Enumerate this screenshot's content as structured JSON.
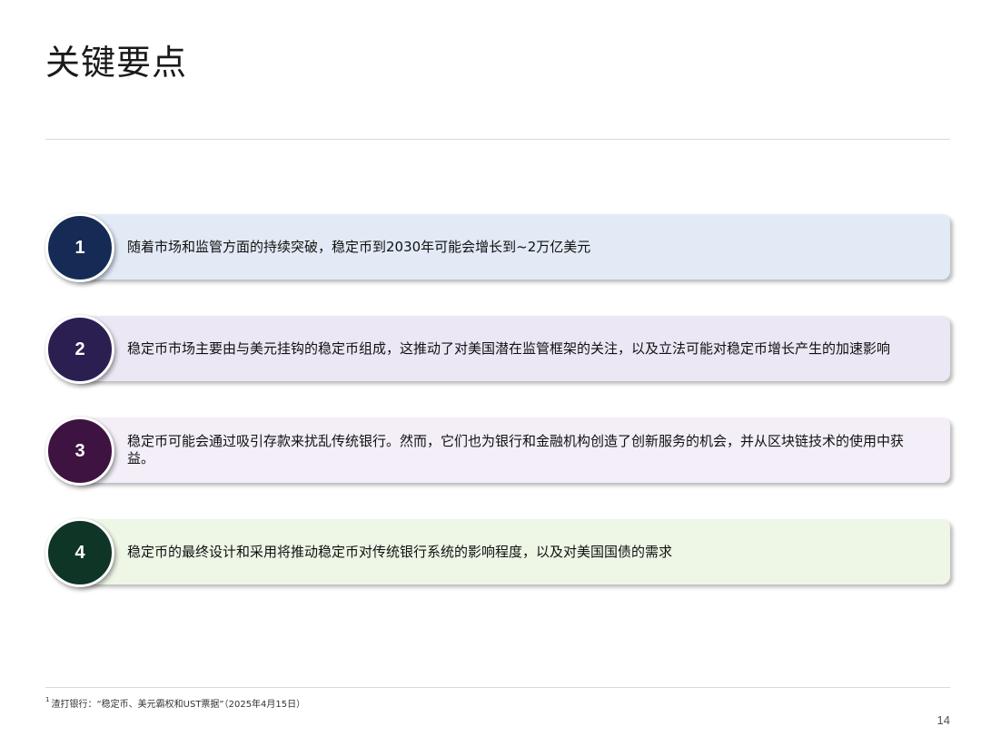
{
  "title": "关键要点",
  "points": [
    {
      "number": "1",
      "text": "随着市场和监管方面的持续突破，稳定币到2030年可能会增长到~2万亿美元",
      "circle_color": "#152b55",
      "bar_color": "#e2eaf5"
    },
    {
      "number": "2",
      "text": "稳定币市场主要由与美元挂钩的稳定币组成，这推动了对美国潜在监管框架的关注，以及立法可能对稳定币增长产生的加速影响",
      "circle_color": "#2b1f52",
      "bar_color": "#ebe7f4"
    },
    {
      "number": "3",
      "text": "稳定币可能会通过吸引存款来扰乱传统银行。然而，它们也为银行和金融机构创造了创新服务的机会，并从区块链技术的使用中获益。",
      "circle_color": "#3e1341",
      "bar_color": "#f3eef8"
    },
    {
      "number": "4",
      "text": "稳定币的最终设计和采用将推动稳定币对传统银行系统的影响程度，以及对美国国债的需求",
      "circle_color": "#0f3526",
      "bar_color": "#eef6e6"
    }
  ],
  "footnote": {
    "marker": "1",
    "text": "渣打银行：“稳定币、美元霸权和UST票据”（2025年4月15日）"
  },
  "page_number": "14"
}
